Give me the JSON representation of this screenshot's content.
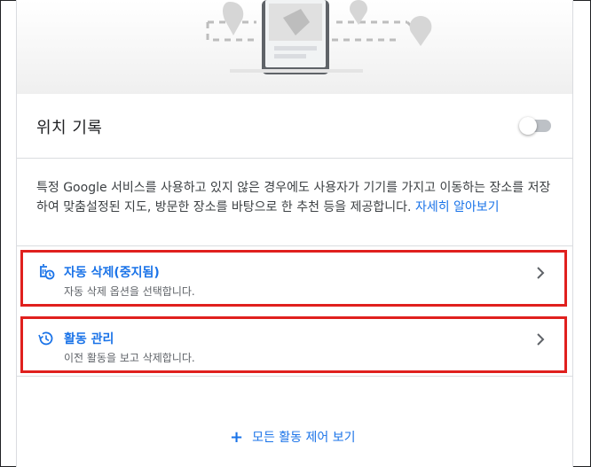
{
  "location_history": {
    "title": "위치 기록",
    "toggle_on": false
  },
  "description": {
    "text": "특정 Google 서비스를 사용하고 있지 않은 경우에도 사용자가 기기를 가지고 이동하는 장소를 저장하여 맞춤설정된 지도, 방문한 장소를 바탕으로 한 추천 등을 제공합니다.",
    "link_label": "자세히 알아보기"
  },
  "items": [
    {
      "title": "자동 삭제(중지됨)",
      "subtitle": "자동 삭제 옵션을 선택합니다.",
      "icon": "auto-delete-icon"
    },
    {
      "title": "활동 관리",
      "subtitle": "이전 활동을 보고 삭제합니다.",
      "icon": "history-icon"
    }
  ],
  "footer": {
    "all_controls_label": "모든 활동 제어 보기"
  },
  "colors": {
    "accent": "#1a73e8",
    "highlight_border": "#e0201e",
    "divider": "#dadce0"
  }
}
